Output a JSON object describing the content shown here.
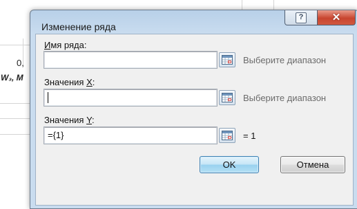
{
  "background": {
    "cell_value_fragment": "0,",
    "cell_formula_fragment": "W₃, M"
  },
  "dialog": {
    "title": "Изменение ряда",
    "help_glyph": "?",
    "close_glyph": "✕",
    "series_name": {
      "label_underlined": "И",
      "label_rest": "мя ряда:",
      "value": "",
      "hint": "Выберите диапазон"
    },
    "x_values": {
      "label_prefix": "Значения ",
      "label_underlined": "X",
      "label_suffix": ":",
      "value": "",
      "hint": "Выберите диапазон"
    },
    "y_values": {
      "label_prefix": "Значения ",
      "label_underlined": "Y",
      "label_suffix": ":",
      "value": "={1}",
      "hint": "= 1"
    },
    "ok_label": "OK",
    "cancel_label": "Отмена"
  },
  "icons": {
    "help": "help-icon",
    "close": "close-icon",
    "range_selector": "range-selector-icon"
  },
  "colors": {
    "title_bar": "#b8d0e8",
    "close_button": "#c8452f",
    "ok_button_border": "#3c7fb1",
    "hint_text": "#6b6b6b"
  }
}
